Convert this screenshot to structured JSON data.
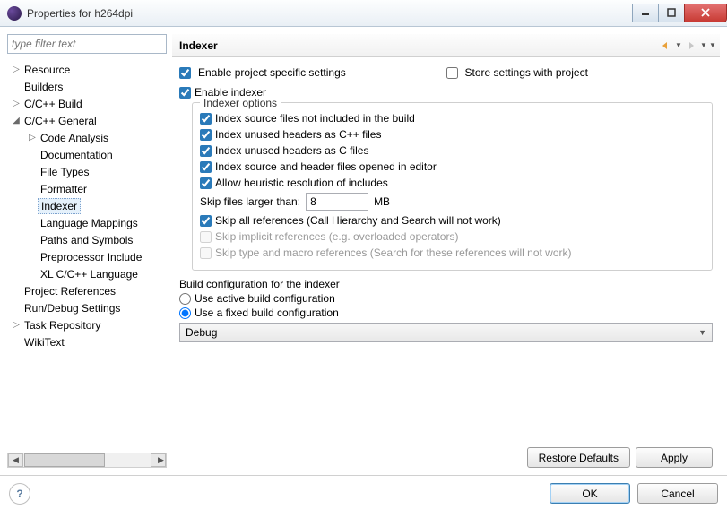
{
  "window": {
    "title": "Properties for h264dpi"
  },
  "filter": {
    "placeholder": "type filter text"
  },
  "tree": {
    "items": [
      {
        "label": "Resource",
        "level": 0,
        "twisty": "▷"
      },
      {
        "label": "Builders",
        "level": 0,
        "twisty": ""
      },
      {
        "label": "C/C++ Build",
        "level": 0,
        "twisty": "▷"
      },
      {
        "label": "C/C++ General",
        "level": 0,
        "twisty": "◢"
      },
      {
        "label": "Code Analysis",
        "level": 1,
        "twisty": "▷"
      },
      {
        "label": "Documentation",
        "level": 1,
        "twisty": ""
      },
      {
        "label": "File Types",
        "level": 1,
        "twisty": ""
      },
      {
        "label": "Formatter",
        "level": 1,
        "twisty": ""
      },
      {
        "label": "Indexer",
        "level": 1,
        "twisty": "",
        "selected": true
      },
      {
        "label": "Language Mappings",
        "level": 1,
        "twisty": ""
      },
      {
        "label": "Paths and Symbols",
        "level": 1,
        "twisty": ""
      },
      {
        "label": "Preprocessor Include",
        "level": 1,
        "twisty": ""
      },
      {
        "label": "XL C/C++ Language",
        "level": 1,
        "twisty": ""
      },
      {
        "label": "Project References",
        "level": 0,
        "twisty": ""
      },
      {
        "label": "Run/Debug Settings",
        "level": 0,
        "twisty": ""
      },
      {
        "label": "Task Repository",
        "level": 0,
        "twisty": "▷"
      },
      {
        "label": "WikiText",
        "level": 0,
        "twisty": ""
      }
    ]
  },
  "pane": {
    "title": "Indexer",
    "enable_specific": "Enable project specific settings",
    "store_with_project": "Store settings with project",
    "enable_indexer": "Enable indexer",
    "group_title": "Indexer options",
    "opt1": "Index source files not included in the build",
    "opt2": "Index unused headers as C++ files",
    "opt3": "Index unused headers as C files",
    "opt4": "Index source and header files opened in editor",
    "opt5": "Allow heuristic resolution of includes",
    "skip_label": "Skip files larger than:",
    "skip_value": "8",
    "skip_unit": "MB",
    "opt6": "Skip all references (Call Hierarchy and Search will not work)",
    "opt7": "Skip implicit references (e.g. overloaded operators)",
    "opt8": "Skip type and macro references (Search for these references will not work)",
    "build_config_label": "Build configuration for the indexer",
    "radio1": "Use active build configuration",
    "radio2": "Use a fixed build configuration",
    "select_value": "Debug",
    "restore": "Restore Defaults",
    "apply": "Apply",
    "ok": "OK",
    "cancel": "Cancel",
    "help": "?"
  }
}
